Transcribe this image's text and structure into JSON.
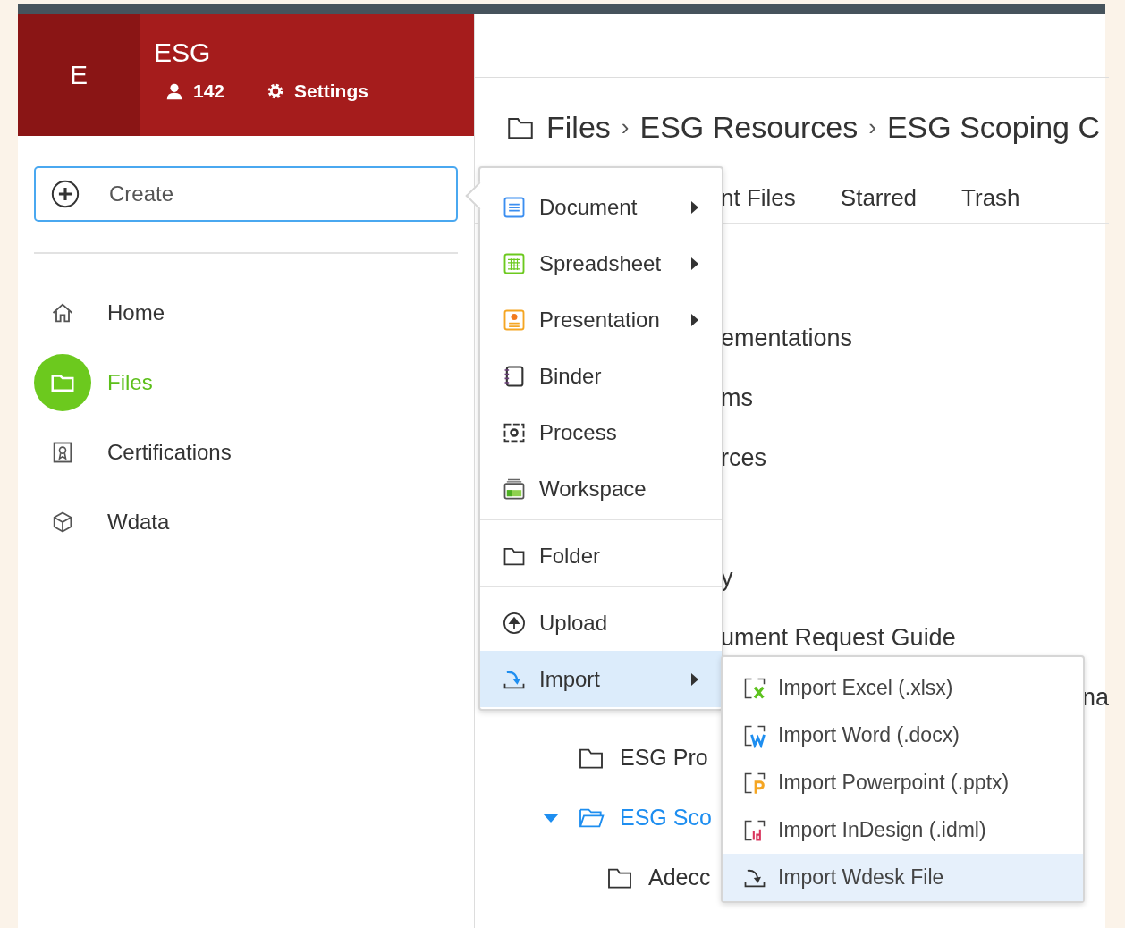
{
  "org": {
    "initial": "E",
    "name": "ESG",
    "member_count": "142",
    "settings_label": "Settings"
  },
  "create_button": {
    "label": "Create",
    "expanded": true
  },
  "nav": [
    {
      "kind": "home",
      "label": "Home",
      "selected": false
    },
    {
      "kind": "files",
      "label": "Files",
      "selected": true
    },
    {
      "kind": "certifications",
      "label": "Certifications",
      "selected": false
    },
    {
      "kind": "wdata",
      "label": "Wdata",
      "selected": false
    }
  ],
  "breadcrumb": [
    {
      "label": "Files"
    },
    {
      "separator": "›",
      "label": "ESG Resources"
    },
    {
      "separator": "›",
      "label": "ESG Scoping C"
    }
  ],
  "tabs": [
    {
      "label": "nt Files",
      "selected": false
    },
    {
      "label": "Starred",
      "selected": false
    },
    {
      "label": "Trash",
      "selected": false
    }
  ],
  "rows_behind_menu": [
    {
      "text": "ementations"
    },
    {
      "text": "ms"
    },
    {
      "text": "rces"
    },
    {
      "text": "y"
    },
    {
      "text": "ument Request Guide"
    }
  ],
  "row_fragment_right": "na",
  "tree": [
    {
      "label": "ESG Pro",
      "expanded": false,
      "selected": false
    },
    {
      "label": "ESG Sco",
      "expanded": true,
      "selected": true,
      "children": [
        {
          "label": "Adecc",
          "expanded": false,
          "selected": false
        }
      ]
    }
  ],
  "create_menu": {
    "groups": [
      {
        "items": [
          {
            "kind": "document",
            "label": "Document",
            "has_submenu": true,
            "selected": false
          },
          {
            "kind": "spreadsheet",
            "label": "Spreadsheet",
            "has_submenu": true,
            "selected": false
          },
          {
            "kind": "presentation",
            "label": "Presentation",
            "has_submenu": true,
            "selected": false
          },
          {
            "kind": "binder",
            "label": "Binder",
            "has_submenu": false,
            "selected": false
          },
          {
            "kind": "process",
            "label": "Process",
            "has_submenu": false,
            "selected": false
          },
          {
            "kind": "workspace",
            "label": "Workspace",
            "has_submenu": false,
            "selected": false
          }
        ]
      },
      {
        "items": [
          {
            "kind": "folder",
            "label": "Folder",
            "has_submenu": false,
            "selected": false
          }
        ]
      },
      {
        "items": [
          {
            "kind": "upload",
            "label": "Upload",
            "has_submenu": false,
            "selected": false
          },
          {
            "kind": "import",
            "label": "Import",
            "has_submenu": true,
            "selected": true
          }
        ]
      }
    ]
  },
  "import_menu": [
    {
      "kind": "excel",
      "label": "Import Excel (.xlsx)",
      "selected": false
    },
    {
      "kind": "word",
      "label": "Import Word (.docx)",
      "selected": false
    },
    {
      "kind": "powerpoint",
      "label": "Import Powerpoint (.pptx)",
      "selected": false
    },
    {
      "kind": "indesign",
      "label": "Import InDesign (.idml)",
      "selected": false
    },
    {
      "kind": "wdesk",
      "label": "Import Wdesk File",
      "selected": true
    }
  ]
}
